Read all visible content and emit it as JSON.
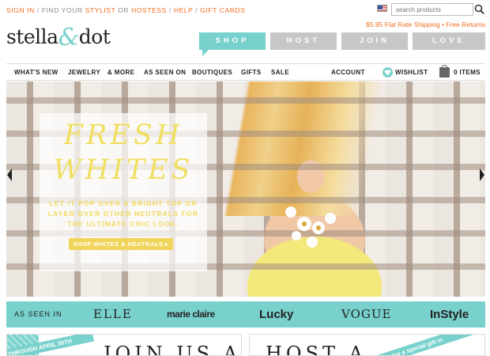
{
  "utility": {
    "sign_in": "SIGN IN",
    "sep1": " / ",
    "find_prefix": "FIND YOUR ",
    "stylist": "STYLIST",
    "or": " OR ",
    "hostess": "HOSTESS",
    "sep2": " / ",
    "help": "HELP",
    "sep3": " / ",
    "gift_cards": "GIFT CARDS"
  },
  "logo": {
    "part1": "stella",
    "amp": "&",
    "part2": "dot"
  },
  "search": {
    "placeholder": "search products"
  },
  "shipping": "$5.95 Flat Rate Shipping • Free Returns",
  "tabs": [
    {
      "label": "SHOP",
      "active": true
    },
    {
      "label": "HOST",
      "active": false
    },
    {
      "label": "JOIN",
      "active": false
    },
    {
      "label": "LOVE",
      "active": false
    }
  ],
  "nav": {
    "items": [
      "WHAT'S NEW",
      "JEWELRY",
      "& MORE",
      "AS SEEN ON",
      "BOUTIQUES",
      "GIFTS",
      "SALE"
    ],
    "account": "ACCOUNT",
    "wishlist": "WISHLIST",
    "cart": "0 ITEMS"
  },
  "hero": {
    "line1": "FRESH",
    "line2": "WHITES",
    "body": "LET IT POP OVER A BRIGHT TOP OR LAYER OVER OTHER NEUTRALS FOR THE ULTIMATE CHIC LOOK.",
    "cta": "SHOP WHITES & NEUTRALS ▸"
  },
  "as_seen_in": {
    "label": "AS SEEN IN",
    "brands": [
      "ELLE",
      "marie claire",
      "Lucky",
      "VOGUE",
      "InStyle"
    ]
  },
  "promos": {
    "join_ribbon": "THROUGH APRIL 30TH",
    "join_title": "JOIN US AS",
    "host_ribbon": "Receive a special gift in",
    "host_title": "HOST A"
  },
  "colors": {
    "accent": "#78d1cc",
    "orange": "#f26d21",
    "yellow": "#f1df62"
  },
  "icons": [
    "us-flag-icon",
    "search-icon",
    "heart-icon",
    "shopping-bag-icon",
    "arrow-left-icon",
    "arrow-right-icon"
  ]
}
